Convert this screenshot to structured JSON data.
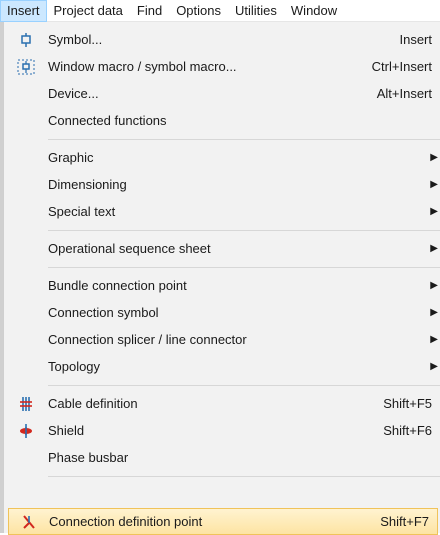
{
  "menubar": {
    "items": [
      "Insert",
      "Project data",
      "Find",
      "Options",
      "Utilities",
      "Window"
    ]
  },
  "menu": {
    "symbol": {
      "label": "Symbol...",
      "shortcut": "Insert",
      "icon": "symbol-icon"
    },
    "window_macro": {
      "label": "Window macro / symbol macro...",
      "shortcut": "Ctrl+Insert",
      "icon": "window-macro-icon"
    },
    "device": {
      "label": "Device...",
      "shortcut": "Alt+Insert"
    },
    "connected_functions": {
      "label": "Connected functions"
    },
    "graphic": {
      "label": "Graphic"
    },
    "dimensioning": {
      "label": "Dimensioning"
    },
    "special_text": {
      "label": "Special text"
    },
    "operational_sequence": {
      "label": "Operational sequence sheet"
    },
    "bundle_connection": {
      "label": "Bundle connection point"
    },
    "connection_symbol": {
      "label": "Connection symbol"
    },
    "connection_splicer": {
      "label": "Connection splicer / line connector"
    },
    "topology": {
      "label": "Topology"
    },
    "cable_definition": {
      "label": "Cable definition",
      "shortcut": "Shift+F5",
      "icon": "cable-definition-icon"
    },
    "shield": {
      "label": "Shield",
      "shortcut": "Shift+F6",
      "icon": "shield-icon"
    },
    "phase_busbar": {
      "label": "Phase busbar"
    },
    "connection_definition_point": {
      "label": "Connection definition point",
      "shortcut": "Shift+F7",
      "icon": "connection-definition-point-icon"
    }
  },
  "colors": {
    "menu_bg": "#f2f2f2",
    "active_menu": "#cce8ff",
    "highlight": "#fde4a3",
    "icon_blue": "#2a6fb0",
    "icon_red": "#d2281e"
  }
}
